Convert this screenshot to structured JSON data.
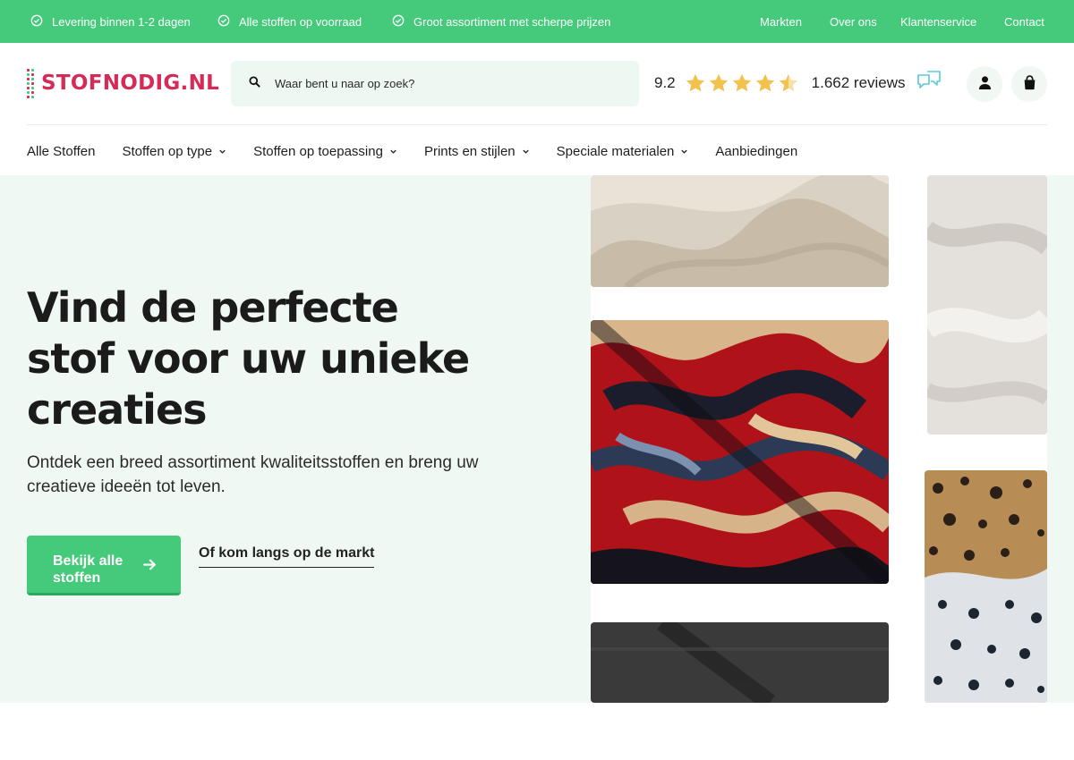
{
  "topbar": {
    "usps": [
      "Levering binnen 1-2 dagen",
      "Alle stoffen op voorraad",
      "Groot assortiment met scherpe prijzen"
    ],
    "links": [
      "Markten",
      "Over ons",
      "Klantenservice",
      "Contact"
    ]
  },
  "header": {
    "logo_text": "STOFNODIG.NL",
    "search_placeholder": "Waar bent u naar op zoek?",
    "rating": {
      "score": "9.2",
      "stars": 4.5,
      "reviews": "1.662 reviews"
    }
  },
  "nav": {
    "items": [
      {
        "label": "Alle Stoffen",
        "dropdown": false
      },
      {
        "label": "Stoffen op type",
        "dropdown": true
      },
      {
        "label": "Stoffen op toepassing",
        "dropdown": true
      },
      {
        "label": "Prints en stijlen",
        "dropdown": true
      },
      {
        "label": "Speciale materialen",
        "dropdown": true
      },
      {
        "label": "Aanbiedingen",
        "dropdown": false
      }
    ]
  },
  "hero": {
    "title": "Vind de perfecte stof voor uw unieke creaties",
    "subtitle": "Ontdek een breed assortiment kwaliteitsstoffen en breng uw creatieve ideeën tot leven.",
    "cta_label": "Bekijk alle stoffen",
    "secondary_link": "Of kom langs op de markt"
  },
  "colors": {
    "brand_green": "#45c97a",
    "brand_red": "#d42b58",
    "hero_bg": "#f0f8f3",
    "star": "#f2c14e"
  },
  "icons": {
    "usp": "check-circle-icon",
    "search": "search-icon",
    "star": "star-icon",
    "kiyoh": "review-bubbles-icon",
    "account": "user-icon",
    "cart": "shopping-bag-icon",
    "dropdown": "chevron-down-icon",
    "cta": "arrow-right-icon"
  }
}
